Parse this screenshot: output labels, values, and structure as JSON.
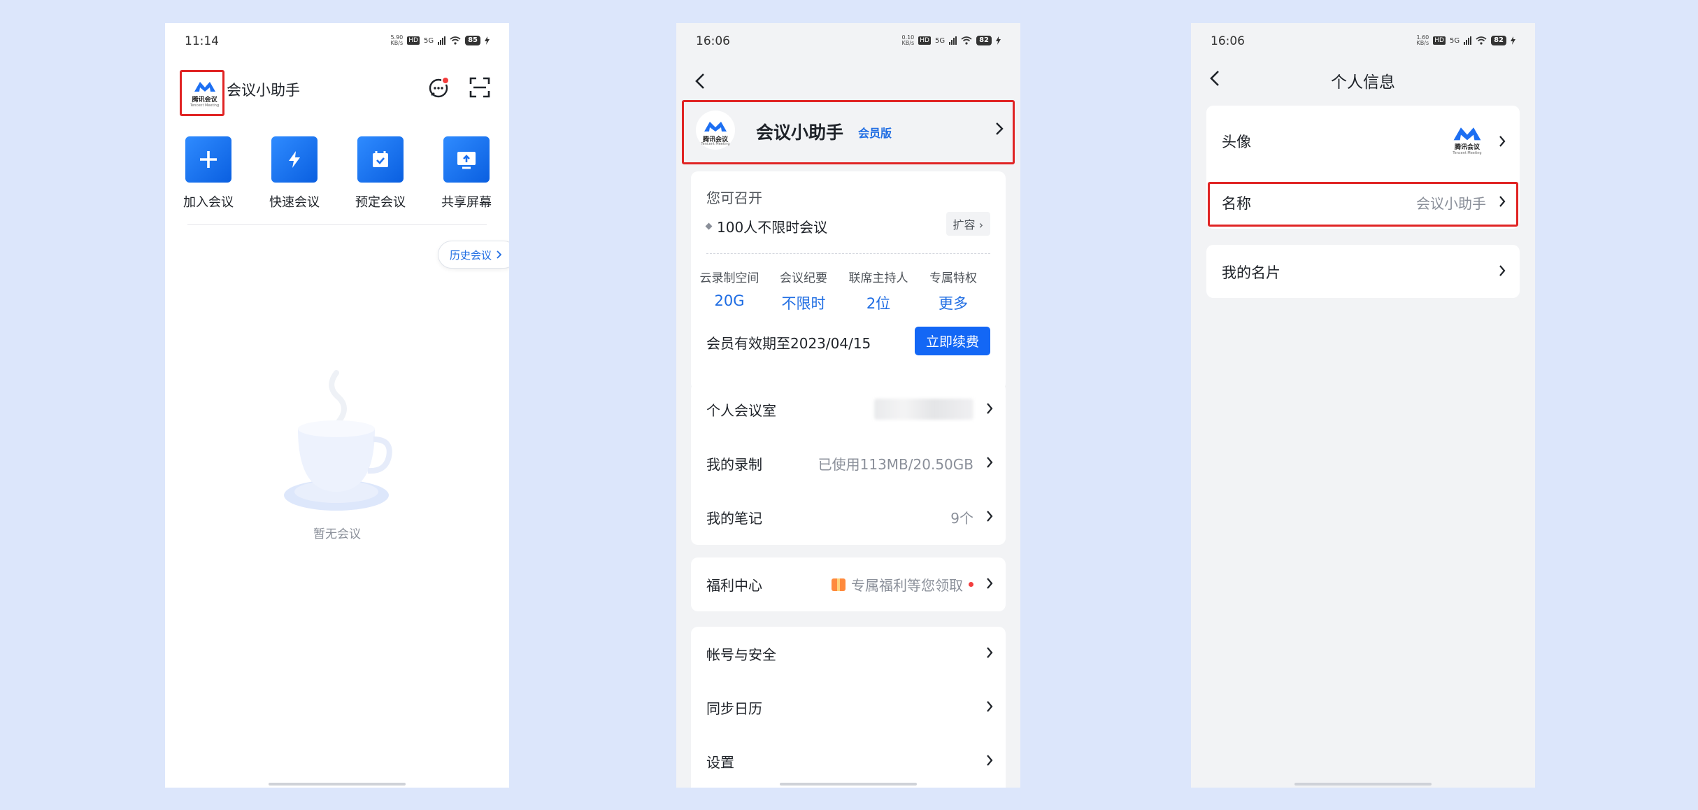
{
  "colors": {
    "accent": "#1367f5",
    "link": "#1f6de3",
    "highlight": "#e02424",
    "background": "#dce6fb"
  },
  "phone1": {
    "status": {
      "time": "11:14",
      "speed_value": "5.90",
      "speed_unit": "KB/s",
      "hd": "HD",
      "network": "5G",
      "battery": "85"
    },
    "logo": {
      "zh": "腾讯会议",
      "en": "Tencent Meeting"
    },
    "title": "会议小助手",
    "actions": [
      {
        "icon": "message-icon"
      },
      {
        "icon": "scan-icon"
      }
    ],
    "tiles": [
      {
        "label": "加入会议",
        "icon": "plus-icon"
      },
      {
        "label": "快速会议",
        "icon": "lightning-icon"
      },
      {
        "label": "预定会议",
        "icon": "calendar-check-icon"
      },
      {
        "label": "共享屏幕",
        "icon": "screen-share-icon"
      }
    ],
    "history_button": "历史会议",
    "empty_text": "暂无会议"
  },
  "phone2": {
    "status": {
      "time": "16:06",
      "speed_value": "0.10",
      "speed_unit": "KB/s",
      "hd": "HD",
      "network": "5G",
      "battery": "82"
    },
    "profile": {
      "name": "会议小助手",
      "tag": "会员版",
      "logo_zh": "腾讯会议",
      "logo_en": "Tencent Meeting"
    },
    "benefits": {
      "heading": "您可召开",
      "capacity": "100人不限时会议",
      "expand": "扩容",
      "stats": [
        {
          "label": "云录制空间",
          "value": "20G"
        },
        {
          "label": "会议纪要",
          "value": "不限时"
        },
        {
          "label": "联席主持人",
          "value": "2位"
        },
        {
          "label": "专属特权",
          "value": "更多"
        }
      ],
      "validity": "会员有效期至2023/04/15",
      "renew": "立即续费"
    },
    "group1": [
      {
        "label": "个人会议室",
        "value": ""
      },
      {
        "label": "我的录制",
        "value": "已使用113MB/20.50GB"
      },
      {
        "label": "我的笔记",
        "value": "9个"
      }
    ],
    "welfare": {
      "label": "福利中心",
      "value": "专属福利等您领取"
    },
    "group2": [
      {
        "label": "帐号与安全"
      },
      {
        "label": "同步日历"
      },
      {
        "label": "设置"
      }
    ]
  },
  "phone3": {
    "status": {
      "time": "16:06",
      "speed_value": "1.60",
      "speed_unit": "KB/s",
      "hd": "HD",
      "network": "5G",
      "battery": "82"
    },
    "title": "个人信息",
    "avatar_row": {
      "label": "头像",
      "logo_zh": "腾讯会议",
      "logo_en": "Tencent Meeting"
    },
    "name_row": {
      "label": "名称",
      "value": "会议小助手"
    },
    "card_row": {
      "label": "我的名片"
    }
  }
}
